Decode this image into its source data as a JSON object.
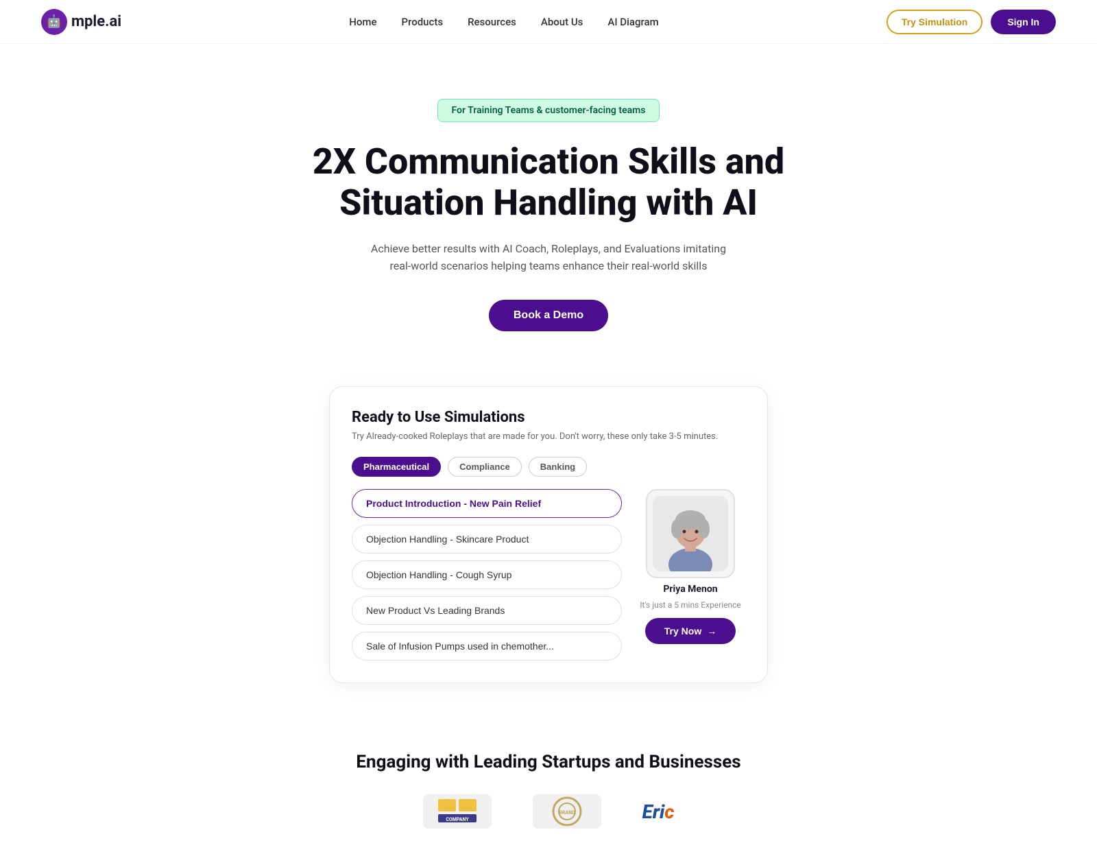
{
  "nav": {
    "logo_emoji": "🤖",
    "logo_text": "mple.ai",
    "links": [
      {
        "label": "Home",
        "id": "home"
      },
      {
        "label": "Products",
        "id": "products"
      },
      {
        "label": "Resources",
        "id": "resources"
      },
      {
        "label": "About Us",
        "id": "about"
      },
      {
        "label": "AI Diagram",
        "id": "ai-diagram"
      }
    ],
    "try_simulation_label": "Try Simulation",
    "sign_in_label": "Sign In"
  },
  "hero": {
    "badge": "For Training Teams & customer-facing teams",
    "title_line1": "2X Communication Skills and",
    "title_line2": "Situation Handling with AI",
    "subtitle": "Achieve better results with AI Coach, Roleplays, and Evaluations imitating real-world scenarios helping teams enhance their real-world skills",
    "cta_label": "Book a Demo"
  },
  "simulation": {
    "title": "Ready to Use Simulations",
    "subtitle": "Try Already-cooked Roleplays that are made for you. Don't worry, these only take 3-5 minutes.",
    "tabs": [
      {
        "label": "Pharmaceutical",
        "active": true
      },
      {
        "label": "Compliance",
        "active": false
      },
      {
        "label": "Banking",
        "active": false
      }
    ],
    "items": [
      {
        "label": "Product Introduction - New Pain Relief",
        "selected": true
      },
      {
        "label": "Objection Handling - Skincare Product",
        "selected": false
      },
      {
        "label": "Objection Handling - Cough Syrup",
        "selected": false
      },
      {
        "label": "New Product Vs Leading Brands",
        "selected": false
      },
      {
        "label": "Sale of Infusion Pumps used in chemother...",
        "selected": false
      }
    ],
    "profile": {
      "name": "Priya Menon",
      "experience_text": "It's just a 5 mins Experience",
      "try_now_label": "Try Now"
    }
  },
  "engaging": {
    "title": "Engaging with Leading Startups and Businesses",
    "brands": [
      {
        "name": "brand-1"
      },
      {
        "name": "brand-2"
      },
      {
        "name": "eric"
      }
    ]
  }
}
